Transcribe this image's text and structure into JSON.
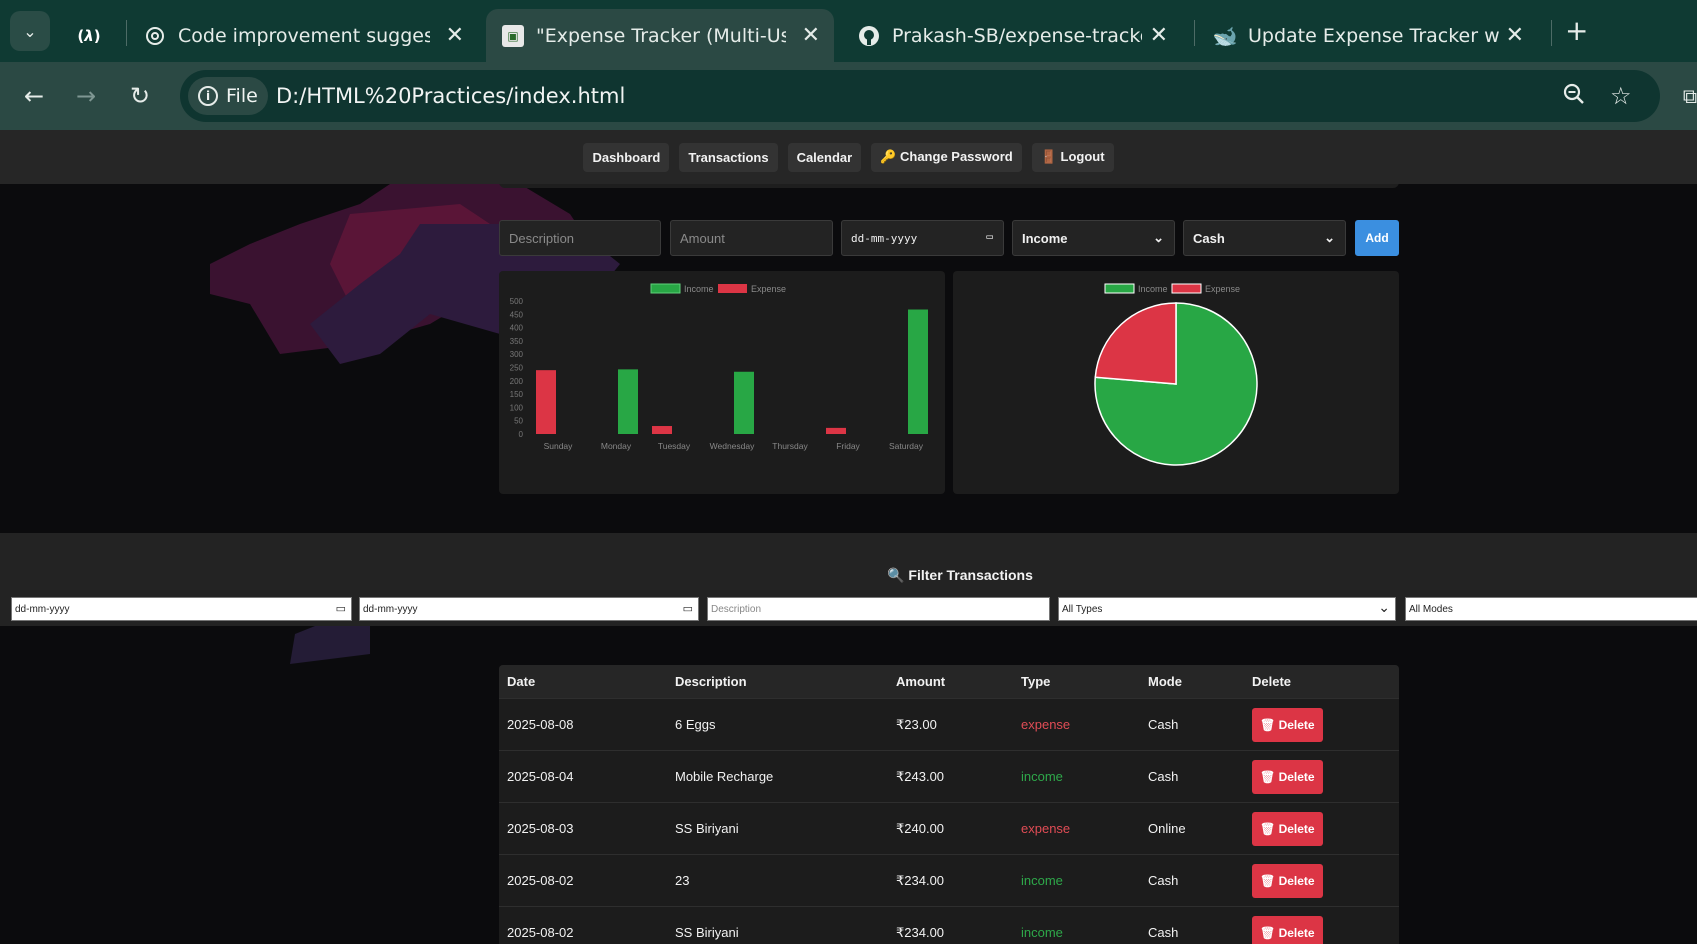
{
  "browser": {
    "tabs": [
      {
        "title": "",
        "icon": "freecodecamp-icon"
      },
      {
        "title": "Code improvement suggestions",
        "icon": "openai-icon"
      },
      {
        "title": "\"Expense Tracker (Multi-User)\"",
        "icon": "page-favicon-icon"
      },
      {
        "title": "Prakash-SB/expense-tracker: Th",
        "icon": "github-icon"
      },
      {
        "title": "Update Expense Tracker with Ne",
        "icon": "deepseek-icon"
      }
    ],
    "chip_label": "File",
    "url": "D:/HTML%20Practices/index.html"
  },
  "nav": {
    "items": [
      "Dashboard",
      "Transactions",
      "Calendar",
      "🔑 Change Password",
      "🚪 Logout"
    ]
  },
  "form": {
    "description_placeholder": "Description",
    "amount_placeholder": "Amount",
    "date_placeholder": "dd-mm-yyyy",
    "type_value": "Income",
    "mode_value": "Cash",
    "add_label": "Add"
  },
  "colors": {
    "income": "#28a745",
    "expense": "#dc3545",
    "add_button": "#3b8fe0"
  },
  "chart_data": [
    {
      "type": "bar",
      "categories": [
        "Sunday",
        "Monday",
        "Tuesday",
        "Wednesday",
        "Thursday",
        "Friday",
        "Saturday"
      ],
      "series": [
        {
          "name": "Income",
          "values": [
            0,
            243,
            0,
            234,
            0,
            0,
            468
          ]
        },
        {
          "name": "Expense",
          "values": [
            240,
            0,
            30,
            0,
            0,
            23,
            0
          ]
        }
      ],
      "y_ticks": [
        "500",
        "450",
        "400",
        "350",
        "300",
        "250",
        "200",
        "150",
        "100",
        "50",
        "0"
      ],
      "ylim": [
        0,
        500
      ],
      "legend": "top"
    },
    {
      "type": "pie",
      "categories": [
        "Income",
        "Expense"
      ],
      "values": [
        945,
        293
      ],
      "legend": "top"
    }
  ],
  "filter": {
    "title": "🔍 Filter Transactions",
    "from_placeholder": "dd-mm-yyyy",
    "to_placeholder": "dd-mm-yyyy",
    "description_placeholder": "Description",
    "type_value": "All Types",
    "mode_value": "All Modes"
  },
  "table": {
    "headers": [
      "Date",
      "Description",
      "Amount",
      "Type",
      "Mode",
      "Delete"
    ],
    "rows": [
      {
        "date": "2025-08-08",
        "description": "6 Eggs",
        "amount": "₹23.00",
        "type": "expense",
        "mode": "Cash",
        "delete": "🗑 Delete"
      },
      {
        "date": "2025-08-04",
        "description": "Mobile Recharge",
        "amount": "₹243.00",
        "type": "income",
        "mode": "Cash",
        "delete": "🗑 Delete"
      },
      {
        "date": "2025-08-03",
        "description": "SS Biriyani",
        "amount": "₹240.00",
        "type": "expense",
        "mode": "Online",
        "delete": "🗑 Delete"
      },
      {
        "date": "2025-08-02",
        "description": "23",
        "amount": "₹234.00",
        "type": "income",
        "mode": "Cash",
        "delete": "🗑 Delete"
      },
      {
        "date": "2025-08-02",
        "description": "SS Biriyani",
        "amount": "₹234.00",
        "type": "income",
        "mode": "Cash",
        "delete": "🗑 Delete"
      }
    ]
  }
}
